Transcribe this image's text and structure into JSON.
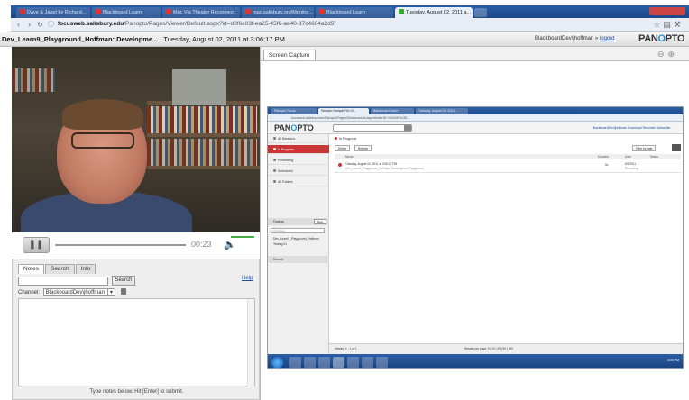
{
  "browser": {
    "tabs": [
      {
        "label": "Dave & Janet by Richard..."
      },
      {
        "label": "Blackboard Learn"
      },
      {
        "label": "Mac Via Theater Reconnect"
      },
      {
        "label": "mac.salisbury.org/Monitor..."
      },
      {
        "label": "Blackboard Learn"
      },
      {
        "label": "Tuesday, August 02, 2011 a..."
      }
    ],
    "url_domain": "focusweb.salisbury.edu",
    "url_path": "/Panopto/Pages/Viewer/Default.aspx?id=d0f6e03f-ea25-45f6-aa40-37c4604a2d5f"
  },
  "header": {
    "session": "Dev_Learn9_Playground_Hoffman: Developme...",
    "date": " | Tuesday, August 02, 2011 at 3:06:17 PM",
    "user": "BlackboardDev\\jhoffman",
    "separator": " » ",
    "logout": "logout",
    "logo_a": "PAN",
    "logo_b": "O",
    "logo_c": "PTO"
  },
  "player": {
    "time": "00:23",
    "progress": 0.0,
    "volume": 0.8
  },
  "notes": {
    "tabs": [
      "Notes",
      "Search",
      "Info"
    ],
    "active_tab": "Notes",
    "search_value": "",
    "search_button": "Search",
    "help": "Help",
    "channel_label": "Channel:",
    "channel_value": "BlackboardDev\\jhoffman",
    "hint": "Type notes below. Hit [Enter] to submit."
  },
  "capture": {
    "tab": "Screen Capture",
    "mini": {
      "tabs": [
        "Panopto Focus",
        "Session Sample Flix Vi...",
        "Blackboard Learn",
        "Tuesday, August 02, 2011 ..."
      ],
      "url": "focusweb.salisbury.edu/Panopto/Pages/Sessions/List.aspx#folderID=%22e5f7e1f8...",
      "logo_a": "PAN",
      "logo_b": "O",
      "logo_c": "PTO",
      "user": "BlackboardDev\\jhoffman  Download Recorder  Subscribe",
      "sidebar": [
        "All Sessions",
        "In Progress",
        "Processing",
        "Scheduled",
        "All Folders"
      ],
      "sidebar_selected": "In Progress",
      "folders_label": "Folders",
      "new_button": "New",
      "folder_search": "All Folders",
      "folders": [
        "Dev_Learn9_Playground_Hoffman",
        "Testing 01"
      ],
      "recent_label": "Recent",
      "crumb": "In Progress",
      "toolbar": [
        "Delete",
        "Refresh"
      ],
      "filter": "Filter by date",
      "columns": [
        "Name",
        "Duration",
        "Date",
        "Status"
      ],
      "row": {
        "title": "Tuesday, August 02, 2011 at 3:06:17 PM",
        "subtitle": "Dev_Learn9_Playground_Hoffman: Development Playground",
        "duration": "0s",
        "date": "8/2/2011",
        "status": "Recording"
      },
      "footer_left": "Viewing 1 - 1 of 1",
      "footer_right": "Results per page: 5 | 10 | 25 | 50 | 100",
      "clock": "3:06 PM"
    }
  },
  "colors": {
    "accent": "#c93636",
    "link": "#1a4fa0",
    "browser_bar": "#2a5fa8"
  }
}
